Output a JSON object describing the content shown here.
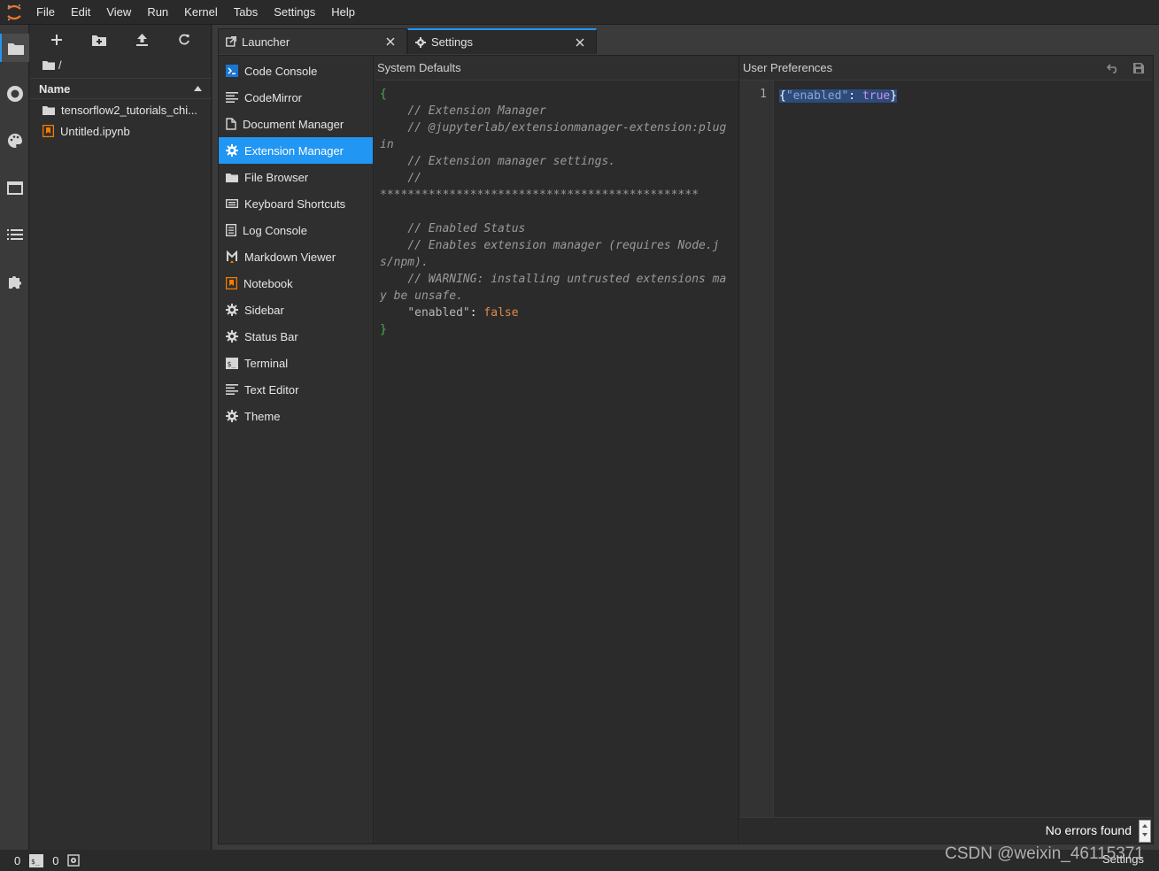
{
  "menubar": {
    "items": [
      "File",
      "Edit",
      "View",
      "Run",
      "Kernel",
      "Tabs",
      "Settings",
      "Help"
    ]
  },
  "filebrowser": {
    "breadcrumb": "/",
    "column_name": "Name",
    "items": [
      {
        "name": "tensorflow2_tutorials_chi...",
        "icon": "folder-icon"
      },
      {
        "name": "Untitled.ipynb",
        "icon": "notebook-icon"
      }
    ]
  },
  "tabs": [
    {
      "label": "Launcher",
      "icon": "launcher-icon"
    },
    {
      "label": "Settings",
      "icon": "gear-icon"
    }
  ],
  "settings_list": [
    {
      "label": "Code Console",
      "icon": "console-icon"
    },
    {
      "label": "CodeMirror",
      "icon": "text-lines-icon"
    },
    {
      "label": "Document Manager",
      "icon": "document-icon"
    },
    {
      "label": "Extension Manager",
      "icon": "gear-icon",
      "active": true
    },
    {
      "label": "File Browser",
      "icon": "folder-icon"
    },
    {
      "label": "Keyboard Shortcuts",
      "icon": "keyboard-icon"
    },
    {
      "label": "Log Console",
      "icon": "log-icon"
    },
    {
      "label": "Markdown Viewer",
      "icon": "markdown-icon"
    },
    {
      "label": "Notebook",
      "icon": "notebook-icon"
    },
    {
      "label": "Sidebar",
      "icon": "gear-icon"
    },
    {
      "label": "Status Bar",
      "icon": "gear-icon"
    },
    {
      "label": "Terminal",
      "icon": "terminal-icon"
    },
    {
      "label": "Text Editor",
      "icon": "text-lines-icon"
    },
    {
      "label": "Theme",
      "icon": "gear-icon"
    }
  ],
  "system_defaults": {
    "title": "System Defaults",
    "open_brace": "{",
    "comment1": "    // Extension Manager",
    "comment2": "    // @jupyterlab/extensionmanager-extension:plugin",
    "comment3": "    // Extension manager settings.",
    "comment4": "    // ",
    "stars": "**********************************************",
    "comment5": "    // Enabled Status",
    "comment6": "    // Enables extension manager (requires Node.js/npm).",
    "comment7": "    // WARNING: installing untrusted extensions may be unsafe.",
    "key": "\"enabled\"",
    "colon": ": ",
    "value": "false",
    "close_brace": "}"
  },
  "user_preferences": {
    "title": "User Preferences",
    "line_number": "1",
    "open_brace": "{",
    "key": "\"enabled\"",
    "colon": ": ",
    "value": "true",
    "close_brace": "}",
    "status": "No errors found"
  },
  "statusbar": {
    "terminals_count": "0",
    "kernels_count": "0",
    "right_label": "Settings"
  },
  "watermark": "CSDN @weixin_46115371",
  "colors": {
    "accent": "#2196f3",
    "notebook_orange": "#f57c00",
    "comment": "#9a9a9a",
    "false_value": "#e08a4a",
    "true_value": "#c792ea"
  }
}
